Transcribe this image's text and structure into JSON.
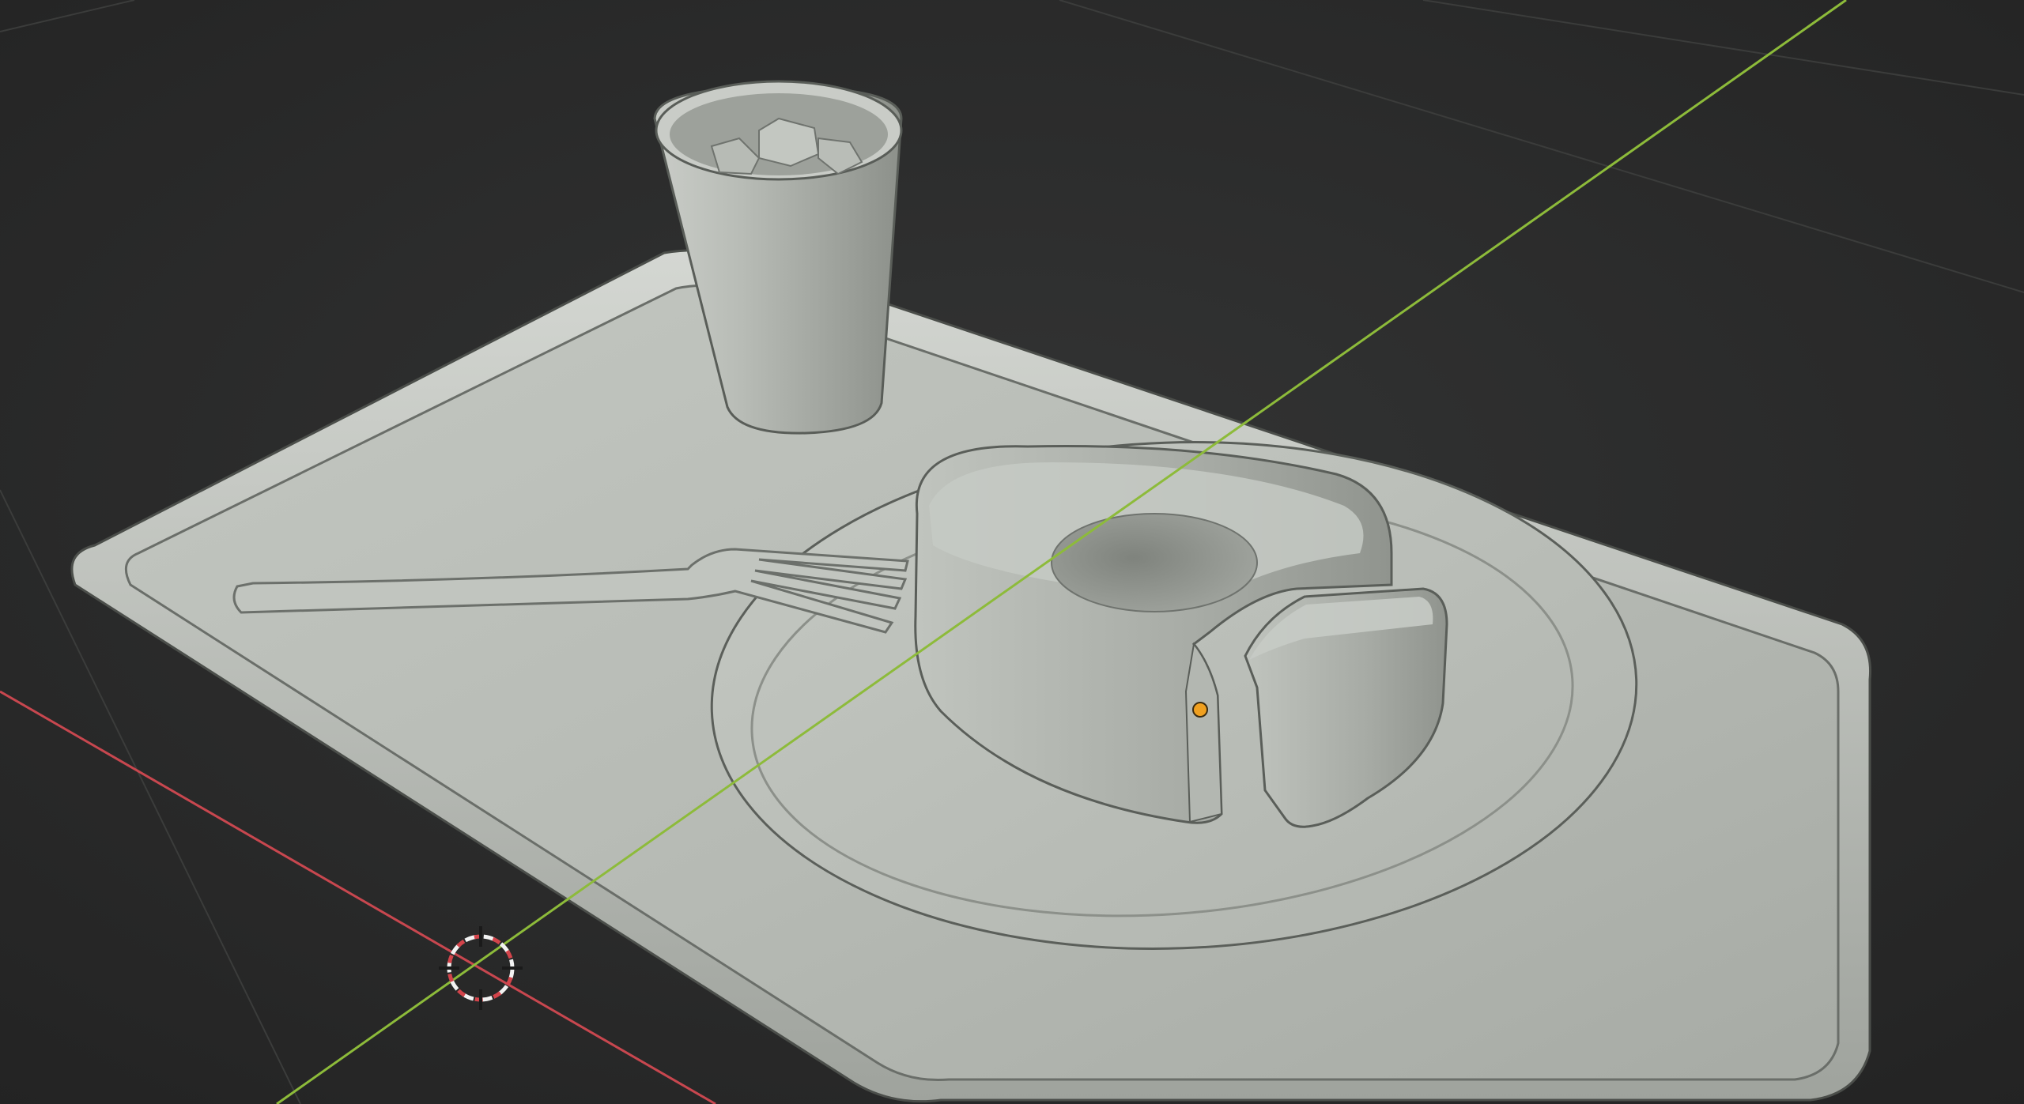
{
  "app": {
    "editor": "3D Viewport",
    "shading_mode": "solid"
  },
  "scene": {
    "objects": [
      "tray",
      "plate",
      "fork",
      "glass",
      "ice-cubes",
      "cake-ring",
      "cake-slice"
    ],
    "has_selection_origin": true,
    "has_3d_cursor": true
  },
  "colors": {
    "background": "#2b2b2b",
    "grid_line": "#3a3a3a",
    "x_axis": "#c8474f",
    "y_axis": "#8dbb3a",
    "object_fill": "#b9bdb7",
    "object_shadow": "#8d918b",
    "object_outline": "#5a5d59",
    "origin_dot": "#f0a020",
    "cursor_ring_red": "#d3444b",
    "cursor_ring_white": "#f2f2f2"
  }
}
